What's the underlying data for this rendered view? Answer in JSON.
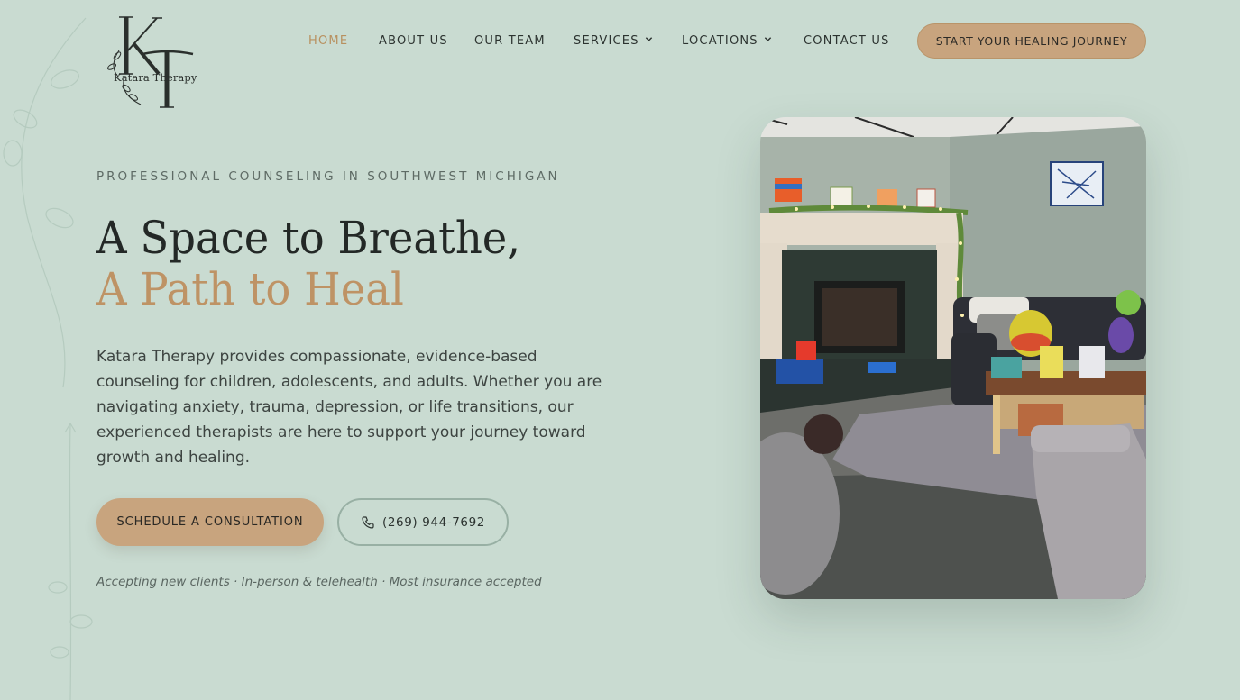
{
  "brand": {
    "name": "Katara Therapy",
    "monogram": "KT"
  },
  "nav": {
    "items": [
      {
        "label": "HOME",
        "active": true
      },
      {
        "label": "ABOUT US"
      },
      {
        "label": "OUR TEAM"
      },
      {
        "label": "SERVICES",
        "dropdown": true
      },
      {
        "label": "LOCATIONS",
        "dropdown": true
      },
      {
        "label": "CONTACT US"
      }
    ],
    "cta_label": "START YOUR HEALING JOURNEY"
  },
  "hero": {
    "eyebrow": "PROFESSIONAL COUNSELING IN SOUTHWEST MICHIGAN",
    "title_line1": "A Space to Breathe,",
    "title_line2": "A Path to Heal",
    "lede": "Katara Therapy provides compassionate, evidence-based counseling for children, adolescents, and adults. Whether you are navigating anxiety, trauma, depression, or life transitions, our experienced therapists are here to support your journey toward growth and healing.",
    "primary_button": "SCHEDULE A CONSULTATION",
    "phone": "(269) 944-7692",
    "note": "Accepting new clients · In-person & telehealth · Most insurance accepted"
  },
  "icons": {
    "phone": "phone-icon",
    "chevron": "chevron-down-icon"
  },
  "colors": {
    "background": "#c9dbd1",
    "accent": "#c8a47e",
    "accent_text": "#be9365",
    "text": "#232826"
  }
}
